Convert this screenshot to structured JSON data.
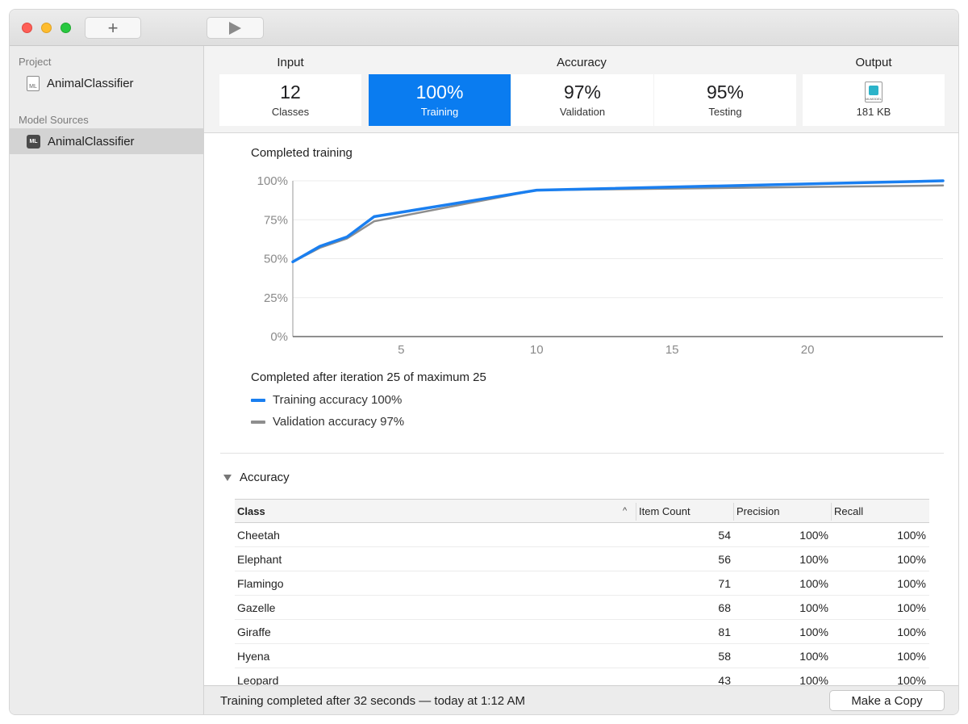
{
  "toolbar": {
    "add_icon": "plus-icon",
    "run_icon": "play-icon"
  },
  "sidebar": {
    "project_header": "Project",
    "project_item": "AnimalClassifier",
    "sources_header": "Model Sources",
    "source_item": "AnimalClassifier"
  },
  "metrics": {
    "input_header": "Input",
    "accuracy_header": "Accuracy",
    "output_header": "Output",
    "cards": [
      {
        "value": "12",
        "label": "Classes"
      },
      {
        "value": "100%",
        "label": "Training",
        "selected": true
      },
      {
        "value": "97%",
        "label": "Validation"
      },
      {
        "value": "95%",
        "label": "Testing"
      }
    ],
    "output_size": "181 KB",
    "output_icon_label": "MLMODEL",
    "accent_color": "#0a7cf0"
  },
  "chart": {
    "title": "Completed training",
    "completed_text": "Completed after iteration 25 of maximum 25",
    "legend": [
      {
        "label": "Training accuracy 100%",
        "color": "#1a7ff0"
      },
      {
        "label": "Validation accuracy 97%",
        "color": "#8e8e8e"
      }
    ]
  },
  "chart_data": {
    "type": "line",
    "title": "Completed training",
    "xlim": [
      1,
      25
    ],
    "ylim": [
      0,
      100
    ],
    "x_ticks": [
      5,
      10,
      15,
      20
    ],
    "y_ticks": [
      "0%",
      "25%",
      "50%",
      "75%",
      "100%"
    ],
    "grid": true,
    "series": [
      {
        "name": "Training accuracy 100%",
        "color": "#1a7ff0",
        "x": [
          1,
          2,
          3,
          4,
          10,
          25
        ],
        "y": [
          48,
          58,
          64,
          77,
          94,
          100
        ]
      },
      {
        "name": "Validation accuracy 97%",
        "color": "#8e8e8e",
        "x": [
          1,
          2,
          3,
          4,
          10,
          25
        ],
        "y": [
          48,
          57,
          63,
          74,
          94,
          97
        ]
      }
    ]
  },
  "accuracy_section": {
    "title": "Accuracy",
    "columns": [
      "Class",
      "Item Count",
      "Precision",
      "Recall"
    ],
    "rows": [
      [
        "Cheetah",
        "54",
        "100%",
        "100%"
      ],
      [
        "Elephant",
        "56",
        "100%",
        "100%"
      ],
      [
        "Flamingo",
        "71",
        "100%",
        "100%"
      ],
      [
        "Gazelle",
        "68",
        "100%",
        "100%"
      ],
      [
        "Giraffe",
        "81",
        "100%",
        "100%"
      ],
      [
        "Hyena",
        "58",
        "100%",
        "100%"
      ],
      [
        "Leopard",
        "43",
        "100%",
        "100%"
      ]
    ]
  },
  "status": {
    "text": "Training completed after 32 seconds — today at 1:12 AM",
    "copy_button": "Make a Copy"
  }
}
